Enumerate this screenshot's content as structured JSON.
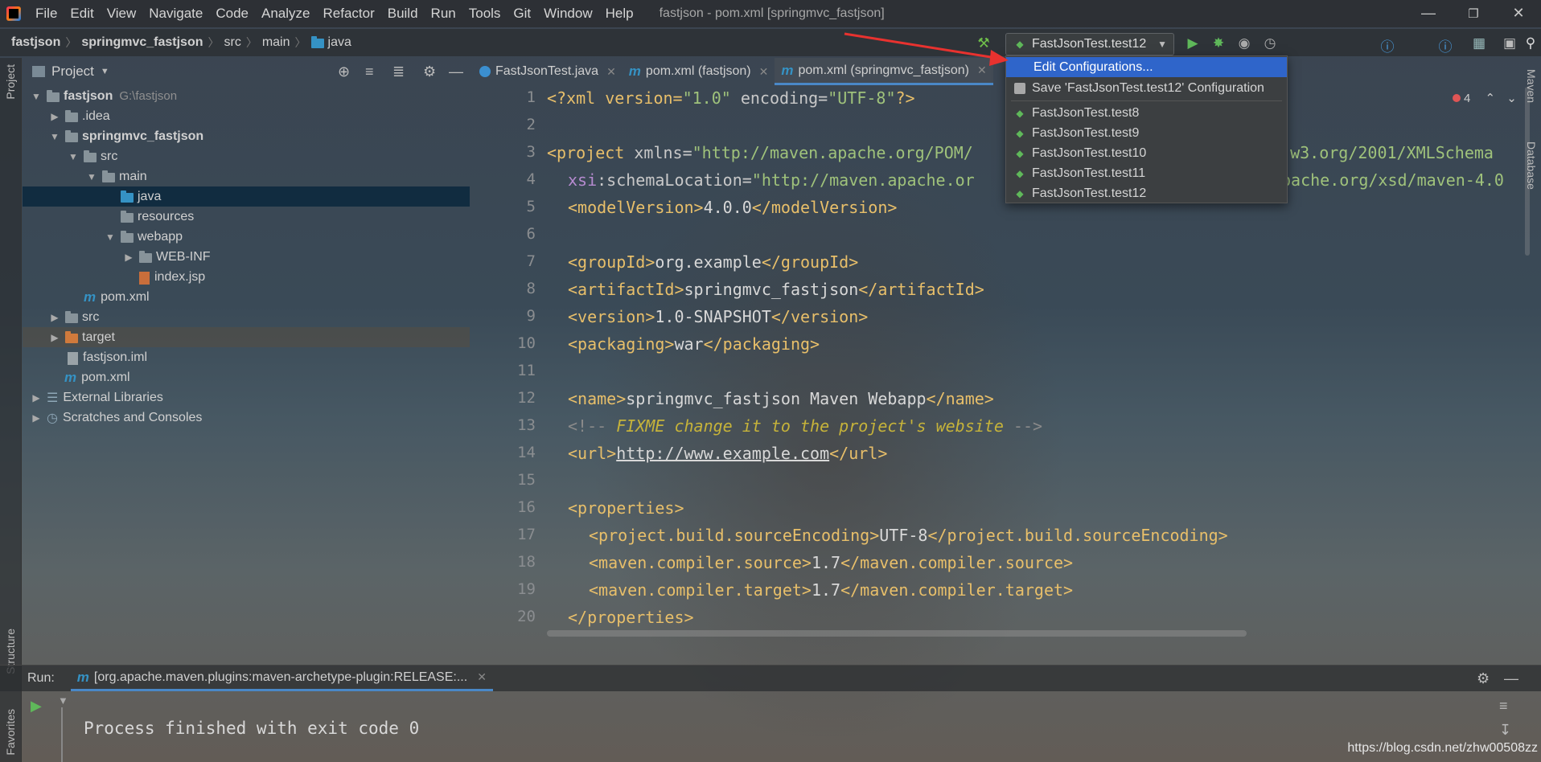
{
  "menubar": {
    "items": [
      "File",
      "Edit",
      "View",
      "Navigate",
      "Code",
      "Analyze",
      "Refactor",
      "Build",
      "Run",
      "Tools",
      "Git",
      "Window",
      "Help"
    ],
    "window_title": "fastjson - pom.xml [springmvc_fastjson]"
  },
  "navbar": {
    "breadcrumbs": [
      "fastjson",
      "springmvc_fastjson",
      "src",
      "main",
      "java"
    ]
  },
  "run_config": {
    "selected": "FastJsonTest.test12",
    "dropdown": {
      "edit": "Edit Configurations...",
      "save": "Save 'FastJsonTest.test12' Configuration",
      "items": [
        "FastJsonTest.test8",
        "FastJsonTest.test9",
        "FastJsonTest.test10",
        "FastJsonTest.test11",
        "FastJsonTest.test12"
      ]
    }
  },
  "side_left": {
    "project": "Project",
    "structure": "Structure",
    "favorites": "Favorites"
  },
  "side_right": {
    "maven": "Maven",
    "database": "Database"
  },
  "project_panel": {
    "title": "Project",
    "tree": [
      {
        "label": "fastjson",
        "extra": "G:\\fastjson",
        "bold": true
      },
      {
        "label": ".idea"
      },
      {
        "label": "springmvc_fastjson",
        "bold": true
      },
      {
        "label": "src"
      },
      {
        "label": "main"
      },
      {
        "label": "java"
      },
      {
        "label": "resources"
      },
      {
        "label": "webapp"
      },
      {
        "label": "WEB-INF"
      },
      {
        "label": "index.jsp"
      },
      {
        "label": "pom.xml"
      },
      {
        "label": "src"
      },
      {
        "label": "target"
      },
      {
        "label": "fastjson.iml"
      },
      {
        "label": "pom.xml"
      },
      {
        "label": "External Libraries"
      },
      {
        "label": "Scratches and Consoles"
      }
    ]
  },
  "editor": {
    "tabs": [
      "FastJsonTest.java",
      "pom.xml (fastjson)",
      "pom.xml (springmvc_fastjson)"
    ],
    "active_tab": 2,
    "error_count": "4",
    "line_numbers": [
      "1",
      "2",
      "3",
      "4",
      "5",
      "6",
      "7",
      "8",
      "9",
      "10",
      "11",
      "12",
      "13",
      "14",
      "15",
      "16",
      "17",
      "18",
      "19",
      "20"
    ],
    "lines": {
      "l1": {
        "a": "<?xml version=",
        "b": "\"1.0\"",
        "c": " encoding=",
        "d": "\"UTF-8\"",
        "e": "?>"
      },
      "l3": {
        "a": "<project ",
        "b": "xmlns=",
        "c": "\"http://maven.apache.org/POM/",
        "d": "w.w3.org/2001/XMLSchema"
      },
      "l4": {
        "a": "xsi",
        "b": ":schemaLocation=",
        "c": "\"http://maven.apache.or",
        "d": "pache.org/xsd/maven-4.0"
      },
      "l5": {
        "a": "<modelVersion>",
        "b": "4.0.0",
        "c": "</modelVersion>"
      },
      "l7": {
        "a": "<groupId>",
        "b": "org.example",
        "c": "</groupId>"
      },
      "l8": {
        "a": "<artifactId>",
        "b": "springmvc_fastjson",
        "c": "</artifactId>"
      },
      "l9": {
        "a": "<version>",
        "b": "1.0-SNAPSHOT",
        "c": "</version>"
      },
      "l10": {
        "a": "<packaging>",
        "b": "war",
        "c": "</packaging>"
      },
      "l12": {
        "a": "<name>",
        "b": "springmvc_fastjson Maven Webapp",
        "c": "</name>"
      },
      "l13": {
        "a": "<!-- ",
        "b": "FIXME change it to the project's website",
        "c": " -->"
      },
      "l14": {
        "a": "<url>",
        "b": "http://www.example.com",
        "c": "</url>"
      },
      "l16": {
        "a": "<properties>"
      },
      "l17": {
        "a": "<project.build.sourceEncoding>",
        "b": "UTF-8",
        "c": "</project.build.sourceEncoding>"
      },
      "l18": {
        "a": "<maven.compiler.source>",
        "b": "1.7",
        "c": "</maven.compiler.source>"
      },
      "l19": {
        "a": "<maven.compiler.target>",
        "b": "1.7",
        "c": "</maven.compiler.target>"
      },
      "l20": {
        "a": "</properties>"
      }
    }
  },
  "run_panel": {
    "label": "Run:",
    "tab": "[org.apache.maven.plugins:maven-archetype-plugin:RELEASE:...",
    "output": "Process finished with exit code 0"
  },
  "watermark": "https://blog.csdn.net/zhw00508zz",
  "colors": {
    "accent": "#2f65ca",
    "tag": "#e8bf6a",
    "string": "#9fc27b",
    "todo": "#c6b33a",
    "selection": "#0d293e"
  }
}
